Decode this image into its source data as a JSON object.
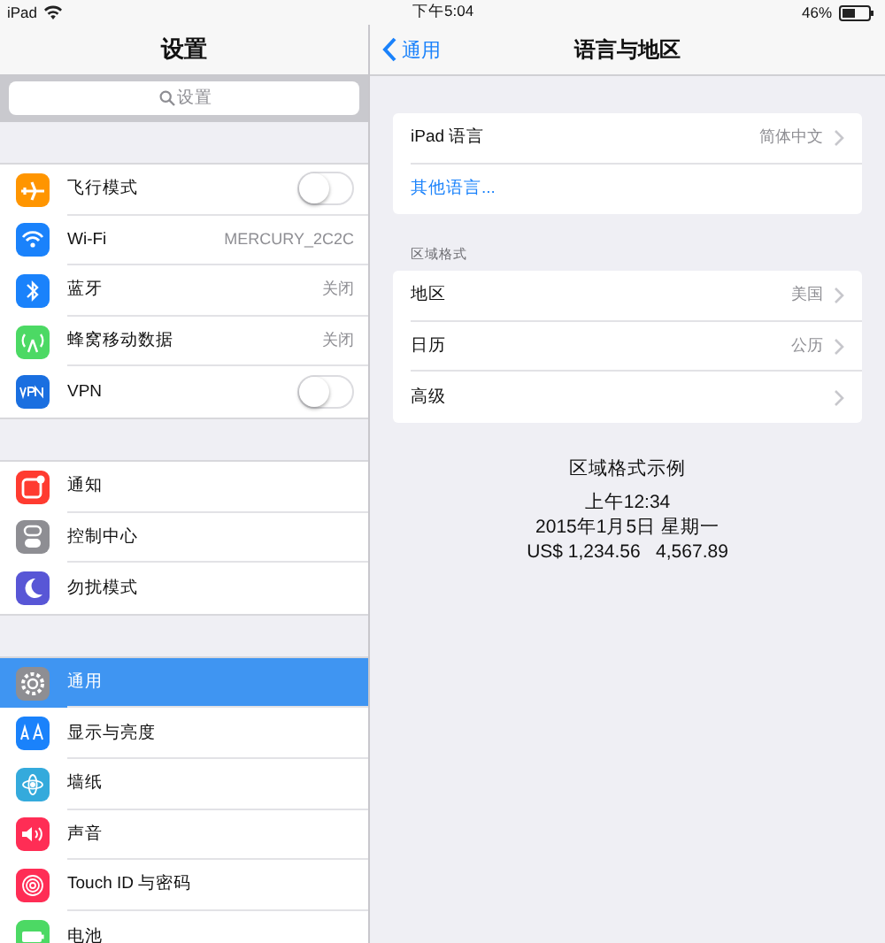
{
  "status_bar": {
    "device": "iPad",
    "time": "下午5:04",
    "battery": "46%"
  },
  "sidebar": {
    "title": "设置",
    "search": {
      "placeholder": "设置"
    },
    "groups": [
      {
        "items": [
          {
            "label": "飞行模式",
            "kind": "toggle",
            "on": false,
            "color": "#ff9500",
            "selected": false
          },
          {
            "label": "Wi-Fi",
            "kind": "value",
            "value": "MERCURY_2C2C",
            "color": "#1a82fb",
            "selected": false
          },
          {
            "label": "蓝牙",
            "kind": "value",
            "value": "关闭",
            "color": "#1a82fb",
            "selected": false
          },
          {
            "label": "蜂窝移动数据",
            "kind": "value",
            "value": "关闭",
            "color": "#4cd964",
            "selected": false
          },
          {
            "label": "VPN",
            "kind": "toggle",
            "on": false,
            "color": "#1a6fe0",
            "selected": false
          }
        ]
      },
      {
        "items": [
          {
            "label": "通知",
            "kind": "plain",
            "color": "#ff3b30",
            "selected": false
          },
          {
            "label": "控制中心",
            "kind": "plain",
            "color": "#8e8e93",
            "selected": false
          },
          {
            "label": "勿扰模式",
            "kind": "plain",
            "color": "#5856d6",
            "selected": false
          }
        ]
      },
      {
        "items": [
          {
            "label": "通用",
            "kind": "plain",
            "color": "#8e8e93",
            "selected": true
          },
          {
            "label": "显示与亮度",
            "kind": "plain",
            "color": "#1a82fb",
            "selected": false
          },
          {
            "label": "墙纸",
            "kind": "plain",
            "color": "#34aadc",
            "selected": false
          },
          {
            "label": "声音",
            "kind": "plain",
            "color": "#ff2d55",
            "selected": false
          },
          {
            "label": "Touch ID 与密码",
            "kind": "plain",
            "color": "#ff2d55",
            "selected": false
          },
          {
            "label": "电池",
            "kind": "plain",
            "color": "#4cd964",
            "selected": false
          }
        ]
      }
    ]
  },
  "detail": {
    "back": "通用",
    "title": "语言与地区",
    "sections": [
      {
        "rows": [
          {
            "label": "iPad 语言",
            "kind": "value",
            "value": "简体中文"
          },
          {
            "label": "其他语言...",
            "kind": "link"
          }
        ]
      },
      {
        "header": "区域格式",
        "rows": [
          {
            "label": "地区",
            "kind": "value",
            "value": "美国"
          },
          {
            "label": "日历",
            "kind": "value",
            "value": "公历"
          },
          {
            "label": "高级",
            "kind": "value"
          }
        ]
      }
    ],
    "example": {
      "title": "区域格式示例",
      "lines": [
        "上午12:34",
        "2015年1月5日 星期一",
        "US$ 1,234.56   4,567.89"
      ]
    }
  }
}
